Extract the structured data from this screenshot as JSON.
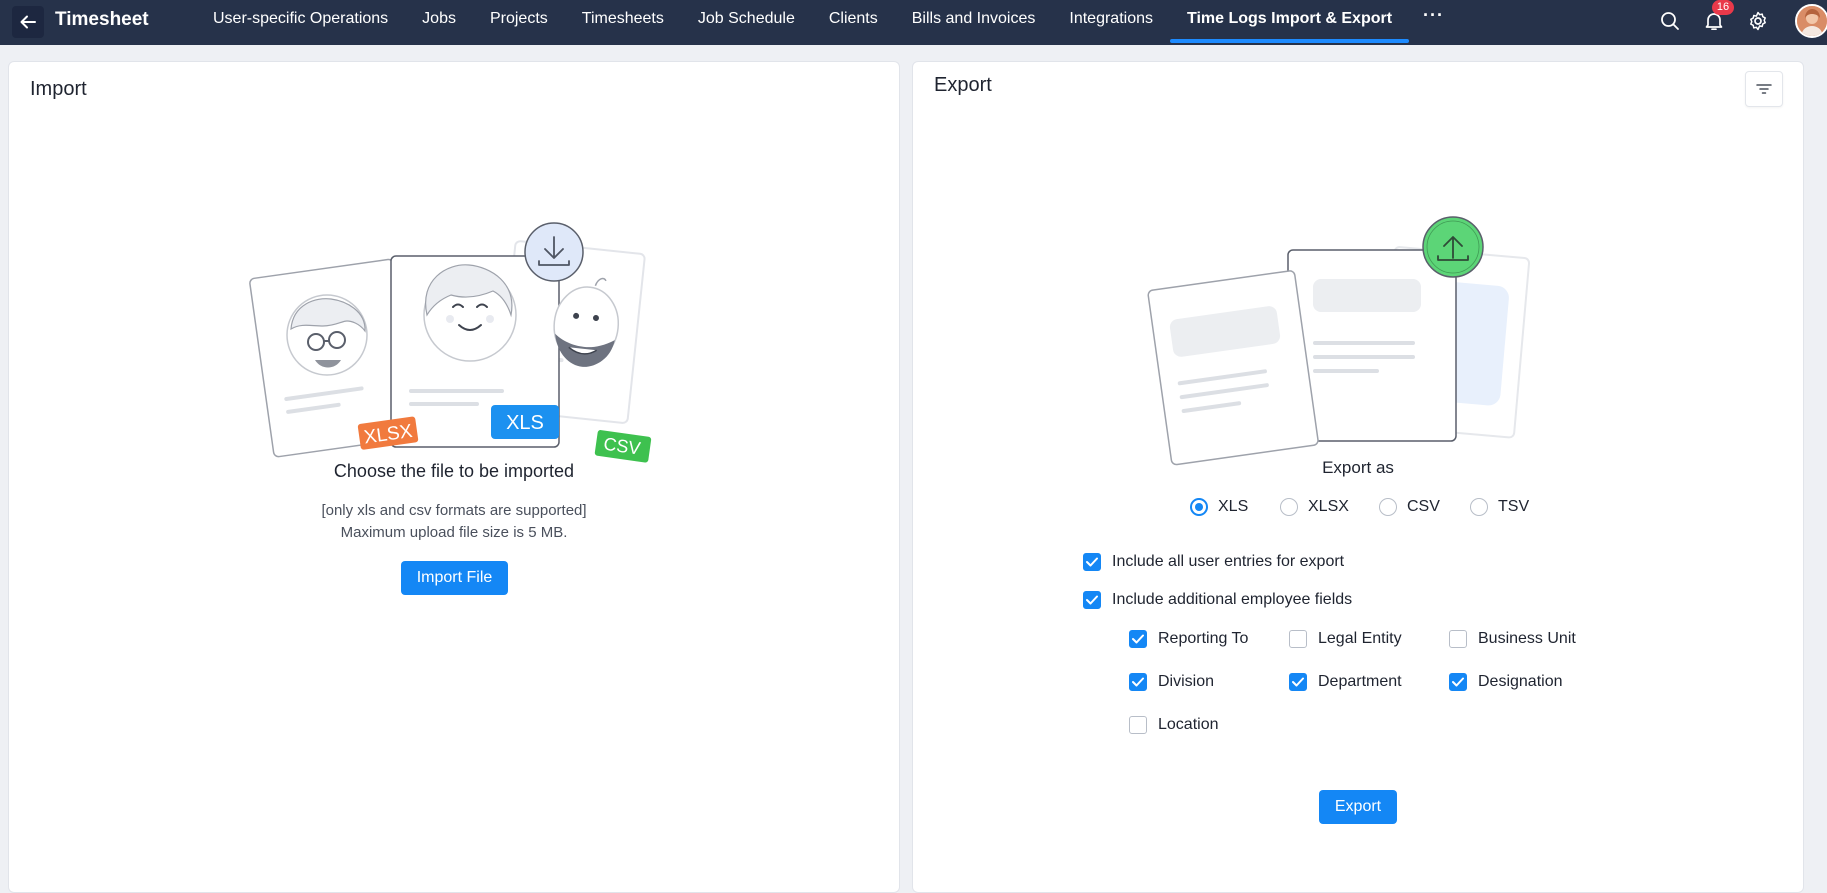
{
  "app": {
    "title": "Timesheet"
  },
  "nav": {
    "items": [
      {
        "label": "User-specific Operations",
        "active": false
      },
      {
        "label": "Jobs",
        "active": false
      },
      {
        "label": "Projects",
        "active": false
      },
      {
        "label": "Timesheets",
        "active": false
      },
      {
        "label": "Job Schedule",
        "active": false
      },
      {
        "label": "Clients",
        "active": false
      },
      {
        "label": "Bills and Invoices",
        "active": false
      },
      {
        "label": "Integrations",
        "active": false
      },
      {
        "label": "Time Logs Import & Export",
        "active": true
      }
    ],
    "more_label": "···"
  },
  "topbar": {
    "notification_count": "16",
    "icons": [
      "search-icon",
      "bell-icon",
      "gear-icon"
    ]
  },
  "import": {
    "title": "Import",
    "illustration": {
      "badges": [
        "XLSX",
        "XLS",
        "CSV"
      ]
    },
    "heading": "Choose the file to be imported",
    "note_line1": "[only xls and csv formats are supported]",
    "note_line2": "Maximum upload file size is 5 MB.",
    "button_label": "Import File"
  },
  "export": {
    "title": "Export",
    "export_as_label": "Export as",
    "formats": [
      {
        "label": "XLS",
        "selected": true
      },
      {
        "label": "XLSX",
        "selected": false
      },
      {
        "label": "CSV",
        "selected": false
      },
      {
        "label": "TSV",
        "selected": false
      }
    ],
    "options": [
      {
        "label": "Include all user entries for export",
        "checked": true
      },
      {
        "label": "Include additional employee fields",
        "checked": true
      }
    ],
    "fields": [
      {
        "label": "Reporting To",
        "checked": true
      },
      {
        "label": "Legal Entity",
        "checked": false
      },
      {
        "label": "Business Unit",
        "checked": false
      },
      {
        "label": "Division",
        "checked": true
      },
      {
        "label": "Department",
        "checked": true
      },
      {
        "label": "Designation",
        "checked": true
      },
      {
        "label": "Location",
        "checked": false
      }
    ],
    "button_label": "Export"
  },
  "colors": {
    "topbar": "#26324a",
    "accent": "#1487f5",
    "badge": "#e9394a"
  }
}
